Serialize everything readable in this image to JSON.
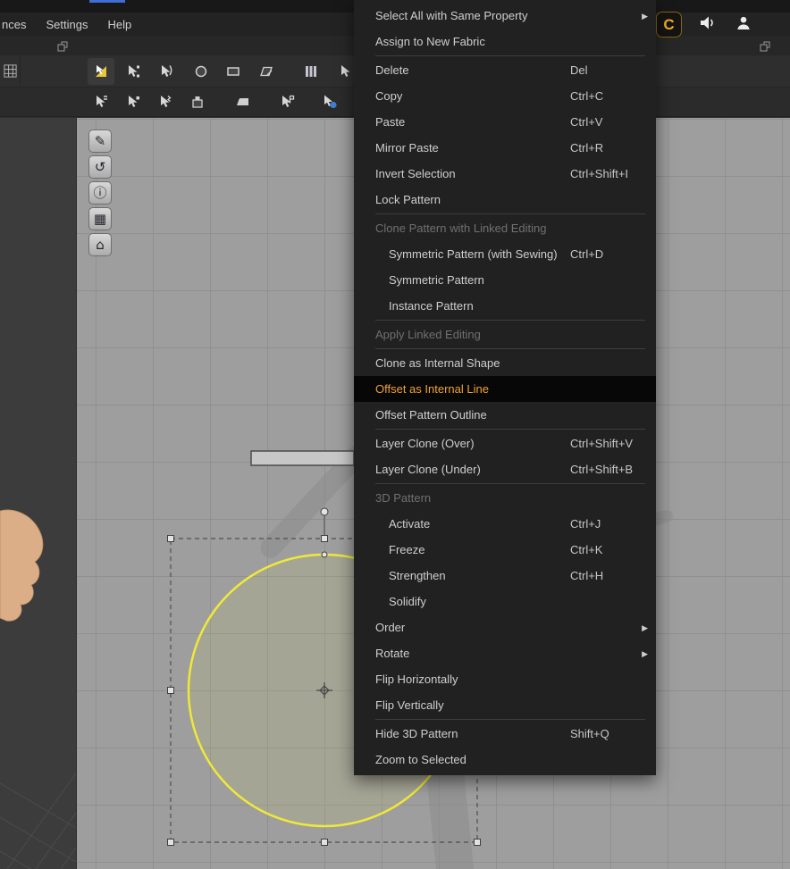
{
  "menubar": {
    "items": [
      "nces",
      "Settings",
      "Help"
    ]
  },
  "header_icons": {
    "logo_text": "C"
  },
  "toolbar_row1": {
    "active_tool": "transform-pattern-tool",
    "tools": [
      "transform-pattern-tool",
      "edit-pattern-tool",
      "edit-curvature-tool",
      "add-point-tool",
      "rectangle-tool",
      "polygon-tool",
      "dart-tool",
      "trace-tool"
    ]
  },
  "toolbar_row2": {
    "tools": [
      "segment-sewing-tool",
      "free-sewing-tool",
      "edit-sewing-tool",
      "pin-tool",
      "iron-tool",
      "tack-tool",
      "fabric-strain-tool"
    ]
  },
  "pattern_tools": {
    "buttons": [
      {
        "name": "pen-tool",
        "glyph": "✎"
      },
      {
        "name": "rotate-view",
        "glyph": "↺"
      },
      {
        "name": "info-toggle",
        "glyph": "ⓘ"
      },
      {
        "name": "grid-toggle",
        "glyph": "▦"
      },
      {
        "name": "home-view",
        "glyph": "⌂"
      }
    ]
  },
  "context_menu": {
    "items": [
      {
        "label": "Select All with Same Property",
        "submenu": true
      },
      {
        "label": "Assign to New Fabric"
      },
      {
        "type": "separator"
      },
      {
        "label": "Delete",
        "shortcut": "Del"
      },
      {
        "label": "Copy",
        "shortcut": "Ctrl+C"
      },
      {
        "label": "Paste",
        "shortcut": "Ctrl+V"
      },
      {
        "label": "Mirror Paste",
        "shortcut": "Ctrl+R"
      },
      {
        "label": "Invert Selection",
        "shortcut": "Ctrl+Shift+I"
      },
      {
        "label": "Lock Pattern"
      },
      {
        "type": "separator"
      },
      {
        "label": "Clone Pattern with Linked Editing",
        "state": "disabled"
      },
      {
        "label": "Symmetric Pattern (with Sewing)",
        "shortcut": "Ctrl+D",
        "indent": true
      },
      {
        "label": "Symmetric Pattern",
        "indent": true
      },
      {
        "label": "Instance Pattern",
        "indent": true
      },
      {
        "type": "separator"
      },
      {
        "label": "Apply Linked Editing",
        "state": "disabled"
      },
      {
        "type": "separator"
      },
      {
        "label": "Clone as Internal Shape"
      },
      {
        "label": "Offset as Internal Line",
        "state": "highlight"
      },
      {
        "label": "Offset Pattern Outline"
      },
      {
        "type": "separator"
      },
      {
        "label": "Layer Clone (Over)",
        "shortcut": "Ctrl+Shift+V"
      },
      {
        "label": "Layer Clone (Under)",
        "shortcut": "Ctrl+Shift+B"
      },
      {
        "type": "separator"
      },
      {
        "label": "3D Pattern",
        "state": "disabled"
      },
      {
        "label": "Activate",
        "shortcut": "Ctrl+J",
        "indent": true
      },
      {
        "label": "Freeze",
        "shortcut": "Ctrl+K",
        "indent": true
      },
      {
        "label": "Strengthen",
        "shortcut": "Ctrl+H",
        "indent": true
      },
      {
        "label": "Solidify",
        "indent": true
      },
      {
        "label": "Order",
        "submenu": true
      },
      {
        "label": "Rotate",
        "submenu": true
      },
      {
        "label": "Flip Horizontally"
      },
      {
        "label": "Flip Vertically"
      },
      {
        "type": "separator"
      },
      {
        "label": "Hide 3D Pattern",
        "shortcut": "Shift+Q"
      },
      {
        "label": "Zoom to Selected"
      }
    ]
  },
  "colors": {
    "accent-orange": "#f0a235",
    "highlight-bg": "#070707",
    "pattern-yellow": "#f0e838",
    "menu-bg": "#212121",
    "menu-text": "#cfcfcf",
    "disabled-text": "#707070",
    "board-bg": "#9e9e9e",
    "grid-line": "#909090",
    "viewport3d-bg": "#3c3c3c",
    "toolbar-bg": "#2e2e2e",
    "logo-yellow": "#f2b01e",
    "blue-accent": "#3d6fd6",
    "skin": "#dcae87"
  }
}
